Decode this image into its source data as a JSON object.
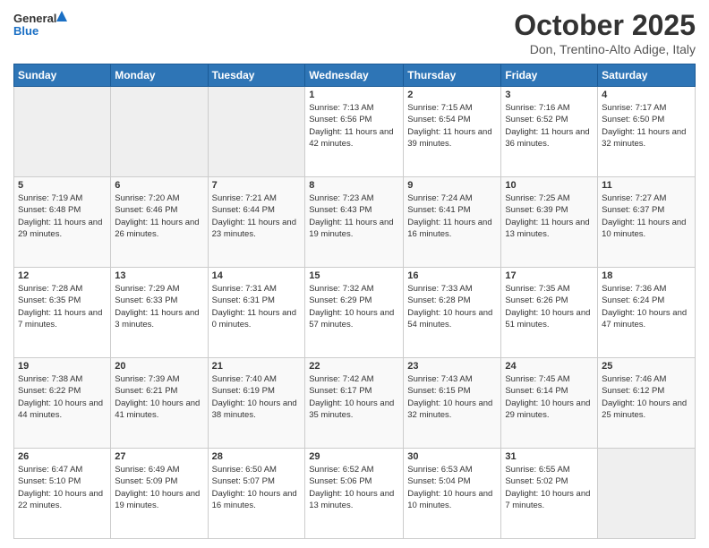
{
  "header": {
    "logo_general": "General",
    "logo_blue": "Blue",
    "month_title": "October 2025",
    "location": "Don, Trentino-Alto Adige, Italy"
  },
  "calendar": {
    "weekdays": [
      "Sunday",
      "Monday",
      "Tuesday",
      "Wednesday",
      "Thursday",
      "Friday",
      "Saturday"
    ],
    "weeks": [
      [
        {
          "day": "",
          "info": ""
        },
        {
          "day": "",
          "info": ""
        },
        {
          "day": "",
          "info": ""
        },
        {
          "day": "1",
          "info": "Sunrise: 7:13 AM\nSunset: 6:56 PM\nDaylight: 11 hours and 42 minutes."
        },
        {
          "day": "2",
          "info": "Sunrise: 7:15 AM\nSunset: 6:54 PM\nDaylight: 11 hours and 39 minutes."
        },
        {
          "day": "3",
          "info": "Sunrise: 7:16 AM\nSunset: 6:52 PM\nDaylight: 11 hours and 36 minutes."
        },
        {
          "day": "4",
          "info": "Sunrise: 7:17 AM\nSunset: 6:50 PM\nDaylight: 11 hours and 32 minutes."
        }
      ],
      [
        {
          "day": "5",
          "info": "Sunrise: 7:19 AM\nSunset: 6:48 PM\nDaylight: 11 hours and 29 minutes."
        },
        {
          "day": "6",
          "info": "Sunrise: 7:20 AM\nSunset: 6:46 PM\nDaylight: 11 hours and 26 minutes."
        },
        {
          "day": "7",
          "info": "Sunrise: 7:21 AM\nSunset: 6:44 PM\nDaylight: 11 hours and 23 minutes."
        },
        {
          "day": "8",
          "info": "Sunrise: 7:23 AM\nSunset: 6:43 PM\nDaylight: 11 hours and 19 minutes."
        },
        {
          "day": "9",
          "info": "Sunrise: 7:24 AM\nSunset: 6:41 PM\nDaylight: 11 hours and 16 minutes."
        },
        {
          "day": "10",
          "info": "Sunrise: 7:25 AM\nSunset: 6:39 PM\nDaylight: 11 hours and 13 minutes."
        },
        {
          "day": "11",
          "info": "Sunrise: 7:27 AM\nSunset: 6:37 PM\nDaylight: 11 hours and 10 minutes."
        }
      ],
      [
        {
          "day": "12",
          "info": "Sunrise: 7:28 AM\nSunset: 6:35 PM\nDaylight: 11 hours and 7 minutes."
        },
        {
          "day": "13",
          "info": "Sunrise: 7:29 AM\nSunset: 6:33 PM\nDaylight: 11 hours and 3 minutes."
        },
        {
          "day": "14",
          "info": "Sunrise: 7:31 AM\nSunset: 6:31 PM\nDaylight: 11 hours and 0 minutes."
        },
        {
          "day": "15",
          "info": "Sunrise: 7:32 AM\nSunset: 6:29 PM\nDaylight: 10 hours and 57 minutes."
        },
        {
          "day": "16",
          "info": "Sunrise: 7:33 AM\nSunset: 6:28 PM\nDaylight: 10 hours and 54 minutes."
        },
        {
          "day": "17",
          "info": "Sunrise: 7:35 AM\nSunset: 6:26 PM\nDaylight: 10 hours and 51 minutes."
        },
        {
          "day": "18",
          "info": "Sunrise: 7:36 AM\nSunset: 6:24 PM\nDaylight: 10 hours and 47 minutes."
        }
      ],
      [
        {
          "day": "19",
          "info": "Sunrise: 7:38 AM\nSunset: 6:22 PM\nDaylight: 10 hours and 44 minutes."
        },
        {
          "day": "20",
          "info": "Sunrise: 7:39 AM\nSunset: 6:21 PM\nDaylight: 10 hours and 41 minutes."
        },
        {
          "day": "21",
          "info": "Sunrise: 7:40 AM\nSunset: 6:19 PM\nDaylight: 10 hours and 38 minutes."
        },
        {
          "day": "22",
          "info": "Sunrise: 7:42 AM\nSunset: 6:17 PM\nDaylight: 10 hours and 35 minutes."
        },
        {
          "day": "23",
          "info": "Sunrise: 7:43 AM\nSunset: 6:15 PM\nDaylight: 10 hours and 32 minutes."
        },
        {
          "day": "24",
          "info": "Sunrise: 7:45 AM\nSunset: 6:14 PM\nDaylight: 10 hours and 29 minutes."
        },
        {
          "day": "25",
          "info": "Sunrise: 7:46 AM\nSunset: 6:12 PM\nDaylight: 10 hours and 25 minutes."
        }
      ],
      [
        {
          "day": "26",
          "info": "Sunrise: 6:47 AM\nSunset: 5:10 PM\nDaylight: 10 hours and 22 minutes."
        },
        {
          "day": "27",
          "info": "Sunrise: 6:49 AM\nSunset: 5:09 PM\nDaylight: 10 hours and 19 minutes."
        },
        {
          "day": "28",
          "info": "Sunrise: 6:50 AM\nSunset: 5:07 PM\nDaylight: 10 hours and 16 minutes."
        },
        {
          "day": "29",
          "info": "Sunrise: 6:52 AM\nSunset: 5:06 PM\nDaylight: 10 hours and 13 minutes."
        },
        {
          "day": "30",
          "info": "Sunrise: 6:53 AM\nSunset: 5:04 PM\nDaylight: 10 hours and 10 minutes."
        },
        {
          "day": "31",
          "info": "Sunrise: 6:55 AM\nSunset: 5:02 PM\nDaylight: 10 hours and 7 minutes."
        },
        {
          "day": "",
          "info": ""
        }
      ]
    ]
  }
}
